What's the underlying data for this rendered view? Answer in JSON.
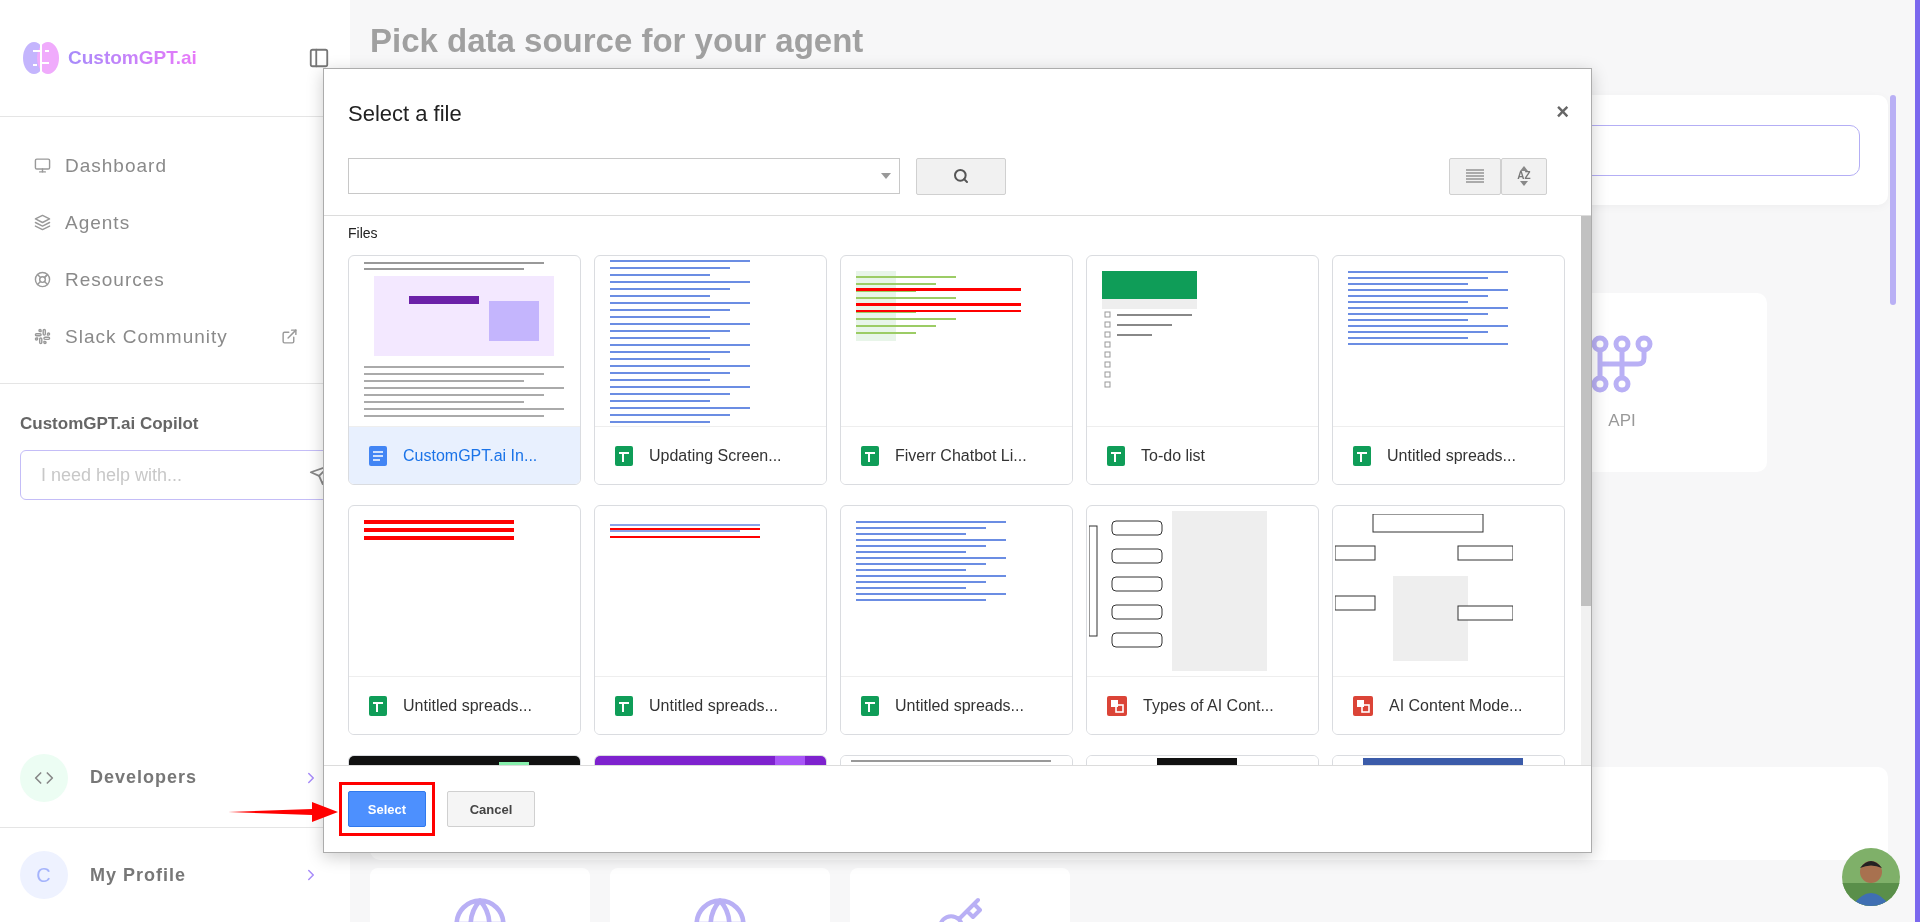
{
  "sidebar": {
    "brand": "CustomGPT.ai",
    "nav": [
      {
        "label": "Dashboard",
        "external": false
      },
      {
        "label": "Agents",
        "external": false
      },
      {
        "label": "Resources",
        "external": false
      },
      {
        "label": "Slack Community",
        "external": true
      }
    ],
    "copilot": {
      "title": "CustomGPT.ai Copilot",
      "placeholder": "I need help with..."
    },
    "developers": {
      "label": "Developers"
    },
    "profile": {
      "label": "My Profile",
      "initial": "C"
    }
  },
  "main": {
    "title": "Pick data source for your agent",
    "source_card": {
      "label": "API"
    }
  },
  "dialog": {
    "title": "Select a file",
    "close": "×",
    "sort_button": {
      "label": "AZ"
    },
    "section": "Files",
    "files": [
      {
        "name": "CustomGPT.ai In...",
        "kind": "doc",
        "selected": true
      },
      {
        "name": "Updating Screen...",
        "kind": "sheet",
        "selected": false
      },
      {
        "name": "Fiverr Chatbot Li...",
        "kind": "sheet",
        "selected": false
      },
      {
        "name": "To-do list",
        "kind": "sheet",
        "selected": false
      },
      {
        "name": "Untitled spreads...",
        "kind": "sheet",
        "selected": false
      },
      {
        "name": "Untitled spreads...",
        "kind": "sheet",
        "selected": false
      },
      {
        "name": "Untitled spreads...",
        "kind": "sheet",
        "selected": false
      },
      {
        "name": "Untitled spreads...",
        "kind": "sheet",
        "selected": false
      },
      {
        "name": "Types of AI Cont...",
        "kind": "slides",
        "selected": false
      },
      {
        "name": "AI Content Mode...",
        "kind": "slides",
        "selected": false
      }
    ],
    "buttons": [
      {
        "label": "Select",
        "kind": "primary",
        "highlighted": true
      },
      {
        "label": "Cancel",
        "kind": "secondary",
        "highlighted": false
      }
    ]
  }
}
